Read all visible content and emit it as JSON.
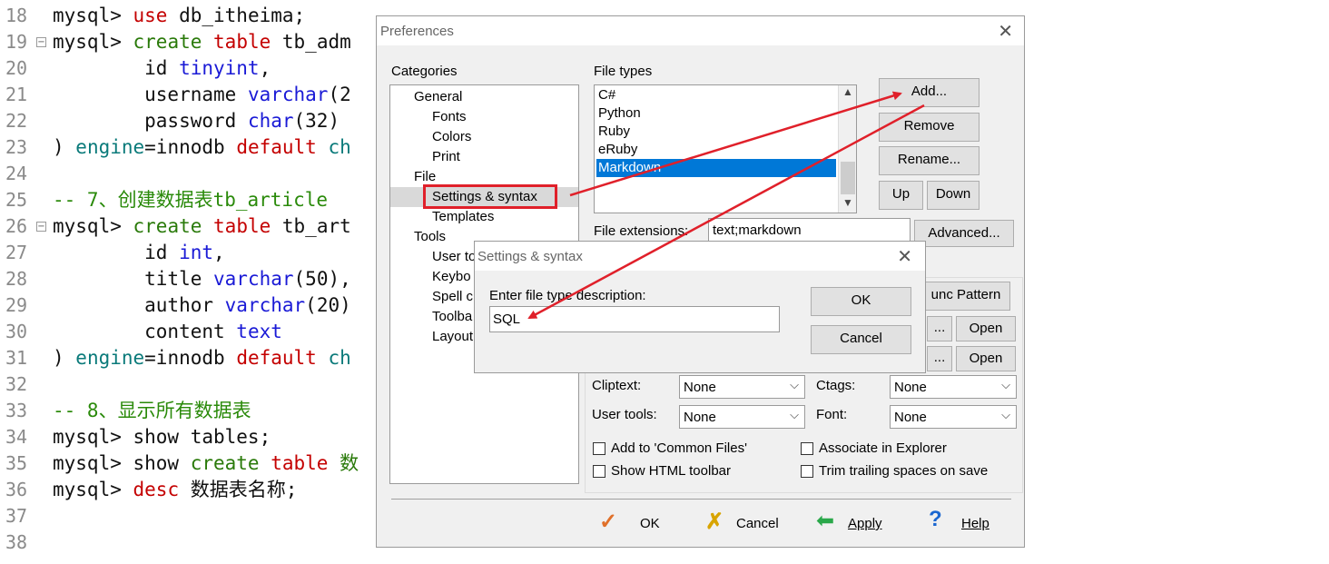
{
  "editor": {
    "lines": [
      {
        "n": "18",
        "fold": false,
        "segs": [
          [
            "mysql> ",
            ""
          ],
          [
            "use",
            "kw"
          ],
          [
            " db_itheima;",
            ""
          ]
        ]
      },
      {
        "n": "19",
        "fold": true,
        "segs": [
          [
            "mysql> ",
            ""
          ],
          [
            "create",
            "gn"
          ],
          [
            " ",
            ""
          ],
          [
            "table",
            "kw"
          ],
          [
            " tb_adm",
            ""
          ]
        ]
      },
      {
        "n": "20",
        "fold": false,
        "segs": [
          [
            "        id ",
            ""
          ],
          [
            "tinyint",
            "ty"
          ],
          [
            ",",
            ""
          ]
        ]
      },
      {
        "n": "21",
        "fold": false,
        "segs": [
          [
            "        username ",
            ""
          ],
          [
            "varchar",
            "ty"
          ],
          [
            "(2",
            ""
          ]
        ]
      },
      {
        "n": "22",
        "fold": false,
        "segs": [
          [
            "        password ",
            ""
          ],
          [
            "char",
            "ty"
          ],
          [
            "(32)",
            ""
          ]
        ]
      },
      {
        "n": "23",
        "fold": false,
        "segs": [
          [
            ") ",
            ""
          ],
          [
            "engine",
            "tl"
          ],
          [
            "=innodb ",
            ""
          ],
          [
            "default",
            "kw"
          ],
          [
            " ch",
            "tl"
          ]
        ]
      },
      {
        "n": "24",
        "fold": false,
        "segs": []
      },
      {
        "n": "25",
        "fold": false,
        "segs": [
          [
            "-- 7、创建数据表tb_article",
            "cm"
          ]
        ]
      },
      {
        "n": "26",
        "fold": true,
        "segs": [
          [
            "mysql> ",
            ""
          ],
          [
            "create",
            "gn"
          ],
          [
            " ",
            ""
          ],
          [
            "table",
            "kw"
          ],
          [
            " tb_art",
            ""
          ]
        ]
      },
      {
        "n": "27",
        "fold": false,
        "segs": [
          [
            "        id ",
            ""
          ],
          [
            "int",
            "ty"
          ],
          [
            ",",
            ""
          ]
        ]
      },
      {
        "n": "28",
        "fold": false,
        "segs": [
          [
            "        title ",
            ""
          ],
          [
            "varchar",
            "ty"
          ],
          [
            "(50),",
            ""
          ]
        ]
      },
      {
        "n": "29",
        "fold": false,
        "segs": [
          [
            "        author ",
            ""
          ],
          [
            "varchar",
            "ty"
          ],
          [
            "(20)",
            ""
          ]
        ]
      },
      {
        "n": "30",
        "fold": false,
        "segs": [
          [
            "        content ",
            ""
          ],
          [
            "text",
            "ty"
          ]
        ]
      },
      {
        "n": "31",
        "fold": false,
        "segs": [
          [
            ") ",
            ""
          ],
          [
            "engine",
            "tl"
          ],
          [
            "=innodb ",
            ""
          ],
          [
            "default",
            "kw"
          ],
          [
            " ch",
            "tl"
          ]
        ]
      },
      {
        "n": "32",
        "fold": false,
        "segs": []
      },
      {
        "n": "33",
        "fold": false,
        "segs": [
          [
            "-- 8、显示所有数据表",
            "cm"
          ]
        ]
      },
      {
        "n": "34",
        "fold": false,
        "segs": [
          [
            "mysql> show tables;",
            ""
          ]
        ]
      },
      {
        "n": "35",
        "fold": false,
        "segs": [
          [
            "mysql> show ",
            ""
          ],
          [
            "create",
            "gn"
          ],
          [
            " ",
            ""
          ],
          [
            "table",
            "kw"
          ],
          [
            " 数",
            "gn"
          ]
        ]
      },
      {
        "n": "36",
        "fold": false,
        "segs": [
          [
            "mysql> ",
            ""
          ],
          [
            "desc",
            "kw"
          ],
          [
            " 数据表名称;",
            ""
          ]
        ]
      },
      {
        "n": "37",
        "fold": false,
        "segs": []
      },
      {
        "n": "38",
        "fold": false,
        "segs": []
      }
    ]
  },
  "prefs": {
    "title": "Preferences",
    "categories_label": "Categories",
    "tree": {
      "general": "General",
      "fonts": "Fonts",
      "colors": "Colors",
      "print": "Print",
      "file": "File",
      "settings_syntax": "Settings & syntax",
      "templates": "Templates",
      "tools": "Tools",
      "user_tools": "User to",
      "keyboard": "Keybo",
      "spell": "Spell c",
      "toolbar": "Toolba",
      "layout": "Layout"
    },
    "file_types_label": "File types",
    "file_types": [
      "C#",
      "Python",
      "Ruby",
      "eRuby",
      "Markdown"
    ],
    "buttons": {
      "add": "Add...",
      "remove": "Remove",
      "rename": "Rename...",
      "up": "Up",
      "down": "Down",
      "advanced": "Advanced...",
      "func_pattern": "unc Pattern",
      "dots": "...",
      "open": "Open"
    },
    "file_extensions_label": "File extensions:",
    "file_extensions_value": "text;markdown",
    "cliptext_label": "Cliptext:",
    "cliptext_value": "None",
    "ctags_label": "Ctags:",
    "ctags_value": "None",
    "user_tools_label": "User tools:",
    "user_tools_value": "None",
    "font_label": "Font:",
    "font_value": "None",
    "checks": {
      "common_files": "Add to 'Common Files'",
      "associate": "Associate in Explorer",
      "html_toolbar": "Show HTML toolbar",
      "trim": "Trim trailing spaces on save"
    },
    "footer": {
      "ok": "OK",
      "cancel": "Cancel",
      "apply": "Apply",
      "help": "Help"
    }
  },
  "inner_dialog": {
    "title": "Settings & syntax",
    "prompt": "Enter file type description:",
    "value": "SQL",
    "ok": "OK",
    "cancel": "Cancel"
  },
  "colors": {
    "highlight_box": "#e0202a",
    "arrow": "#e0202a",
    "selection": "#0078d7"
  }
}
